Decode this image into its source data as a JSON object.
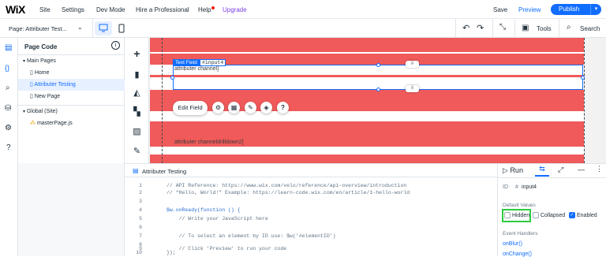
{
  "topbar": {
    "logo": "WiX",
    "menu": [
      "Site",
      "Settings",
      "Dev Mode",
      "Hire a Professional",
      "Help",
      "Upgrade"
    ],
    "save": "Save",
    "preview": "Preview",
    "publish": "Publish"
  },
  "toolbar": {
    "page_label": "Page: Attributer Test...",
    "tools": "Tools",
    "search": "Search"
  },
  "panel": {
    "title": "Page Code",
    "main_pages": "Main Pages",
    "pages": [
      "Home",
      "Attributer Testing",
      "New Page"
    ],
    "global": "Global (Site)",
    "global_files": [
      "masterPage.js"
    ]
  },
  "canvas": {
    "tag_label": "Text Field",
    "tag_id": "#input4",
    "text1": "attributer channel]",
    "text2": "attributer channeldrilldown2]",
    "edit_field": "Edit Field"
  },
  "code": {
    "tab_title": "Attributer Testing",
    "lines": [
      {
        "n": "1",
        "t": "// API Reference: https://www.wix.com/velo/reference/api-overview/introduction"
      },
      {
        "n": "2",
        "t": "// “Hello, World!” Example: https://learn-code.wix.com/en/article/1-hello-world"
      },
      {
        "n": "3",
        "t": ""
      },
      {
        "n": "4",
        "t": "$w.onReady(function () {"
      },
      {
        "n": "5",
        "t": "    // Write your JavaScript here"
      },
      {
        "n": "6",
        "t": ""
      },
      {
        "n": "7",
        "t": "    // To select an element by ID use: $w('#elementID')"
      },
      {
        "n": "8",
        "t": ""
      },
      {
        "n": "9",
        "t": "    // Click 'Preview' to run your code"
      },
      {
        "n": "10",
        "t": "});"
      }
    ]
  },
  "props": {
    "run": "Run",
    "id_label": "ID",
    "id_value": "input4",
    "default_values": "Default Values",
    "hidden": "Hidden",
    "collapsed": "Collapsed",
    "enabled": "Enabled",
    "event_handlers": "Event Handlers",
    "handlers": [
      "onBlur()",
      "onChange()"
    ]
  },
  "colors": {
    "accent": "#116dff",
    "canvas_red": "#f05a5a",
    "highlight": "#2ecc40"
  }
}
